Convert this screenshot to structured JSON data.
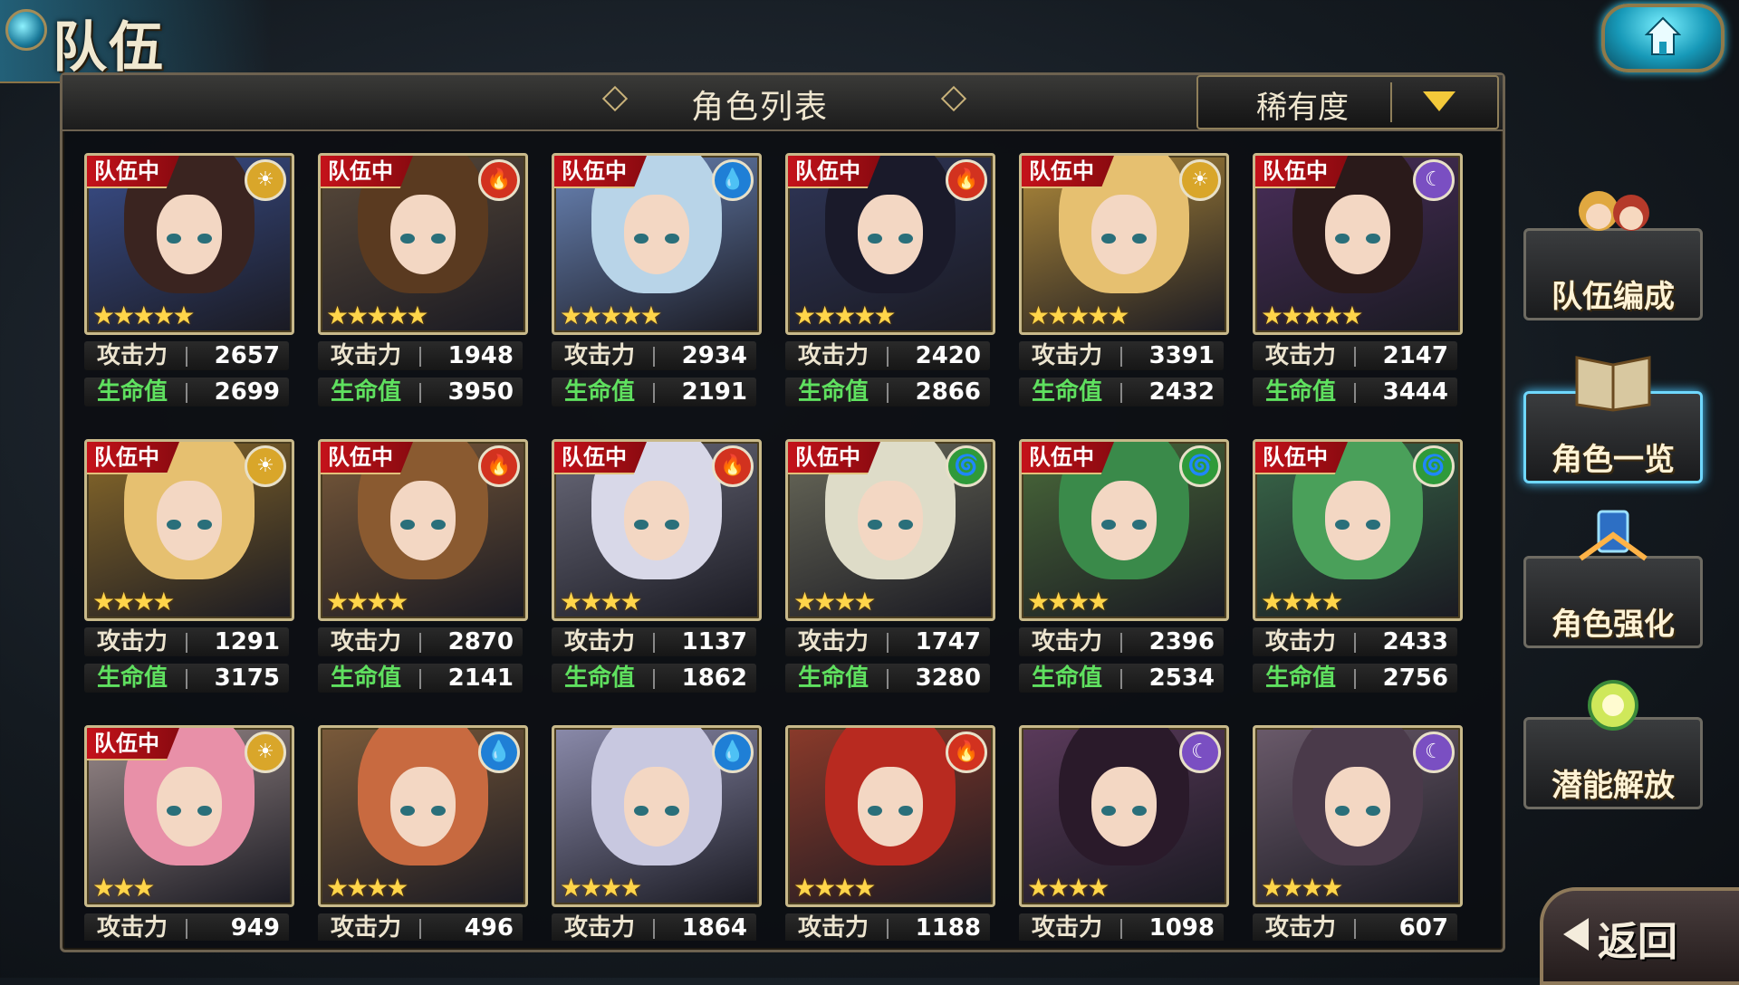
{
  "header": {
    "title": "队伍"
  },
  "panel": {
    "title": "角色列表",
    "sort_label": "稀有度"
  },
  "team_tag": "队伍中",
  "atk_label": "攻击力",
  "hp_label": "生命值",
  "side_menu": [
    "队伍编成",
    "角色一览",
    "角色强化",
    "潜能解放"
  ],
  "back_label": "返回",
  "colors": {
    "sun": "#d9a62a",
    "fire": "#d2321f",
    "water": "#1f7fd6",
    "moon": "#7a4fc2",
    "wind": "#2f9a3a"
  },
  "rows": [
    [
      {
        "in_team": true,
        "element": "sun",
        "stars": "★★★★★",
        "atk": "2657",
        "hp": "2699"
      },
      {
        "in_team": true,
        "element": "fire",
        "stars": "★★★★★",
        "atk": "1948",
        "hp": "3950"
      },
      {
        "in_team": true,
        "element": "water",
        "stars": "★★★★★",
        "atk": "2934",
        "hp": "2191"
      },
      {
        "in_team": true,
        "element": "fire",
        "stars": "★★★★★",
        "atk": "2420",
        "hp": "2866"
      },
      {
        "in_team": true,
        "element": "sun",
        "stars": "★★★★★",
        "atk": "3391",
        "hp": "2432"
      },
      {
        "in_team": true,
        "element": "moon",
        "stars": "★★★★★",
        "atk": "2147",
        "hp": "3444"
      }
    ],
    [
      {
        "in_team": true,
        "element": "sun",
        "stars": "★★★★",
        "atk": "1291",
        "hp": "3175"
      },
      {
        "in_team": true,
        "element": "fire",
        "stars": "★★★★",
        "atk": "2870",
        "hp": "2141"
      },
      {
        "in_team": true,
        "element": "fire",
        "stars": "★★★★",
        "atk": "1137",
        "hp": "1862"
      },
      {
        "in_team": true,
        "element": "wind",
        "stars": "★★★★",
        "atk": "1747",
        "hp": "3280"
      },
      {
        "in_team": true,
        "element": "wind",
        "stars": "★★★★",
        "atk": "2396",
        "hp": "2534"
      },
      {
        "in_team": true,
        "element": "wind",
        "stars": "★★★★",
        "atk": "2433",
        "hp": "2756"
      }
    ],
    [
      {
        "in_team": true,
        "element": "sun",
        "stars": "★★★",
        "atk": "949",
        "hp": ""
      },
      {
        "in_team": false,
        "element": "water",
        "stars": "★★★★",
        "atk": "496",
        "hp": ""
      },
      {
        "in_team": false,
        "element": "water",
        "stars": "★★★★",
        "atk": "1864",
        "hp": ""
      },
      {
        "in_team": false,
        "element": "fire",
        "stars": "★★★★",
        "atk": "1188",
        "hp": ""
      },
      {
        "in_team": false,
        "element": "moon",
        "stars": "★★★★",
        "atk": "1098",
        "hp": ""
      },
      {
        "in_team": false,
        "element": "moon",
        "stars": "★★★★",
        "atk": "607",
        "hp": ""
      }
    ]
  ]
}
